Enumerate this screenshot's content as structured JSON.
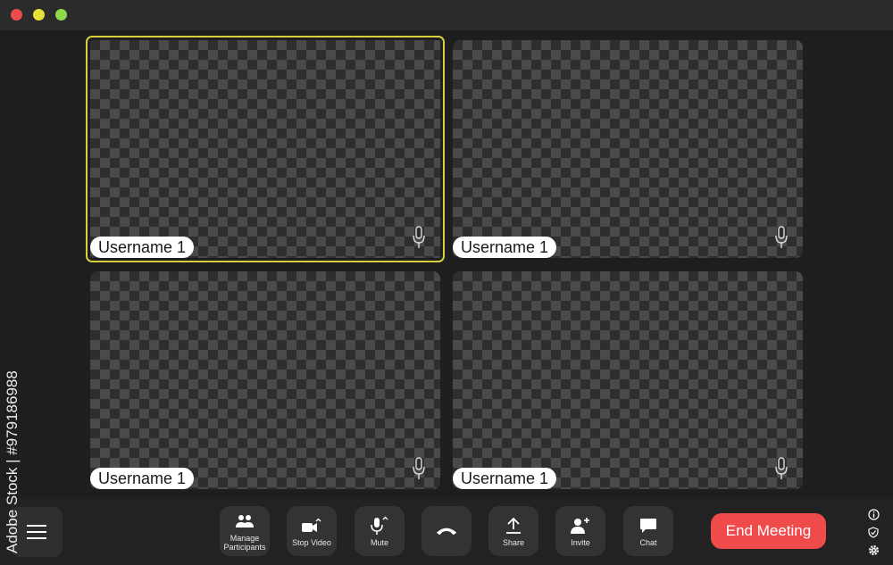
{
  "window": {
    "controls": {
      "close_color": "#ec4c4c",
      "minimize_color": "#e7e13a",
      "maximize_color": "#8ed94b"
    }
  },
  "participants": [
    {
      "name": "Username 1",
      "mic_icon": "microphone-icon",
      "active": true
    },
    {
      "name": "Username 1",
      "mic_icon": "microphone-icon",
      "active": false
    },
    {
      "name": "Username 1",
      "mic_icon": "microphone-icon",
      "active": false
    },
    {
      "name": "Username 1",
      "mic_icon": "microphone-icon",
      "active": false
    }
  ],
  "toolbar": {
    "menu_icon": "hamburger-menu-icon",
    "manage_participants": "Manage\nParticipants",
    "stop_video": "Stop Video",
    "mute": "Mute",
    "hang_up_icon": "phone-hangup-icon",
    "share": "Share",
    "invite": "Invite",
    "chat": "Chat",
    "end_meeting": "End Meeting",
    "end_color": "#ef4b4b",
    "side_icons": [
      "info-icon",
      "shield-icon",
      "gear-icon"
    ]
  },
  "watermark": {
    "vertical_text": "Adobe Stock | #979186988"
  },
  "colors": {
    "active_border": "#d4d13c",
    "background": "#1e1e1e"
  }
}
